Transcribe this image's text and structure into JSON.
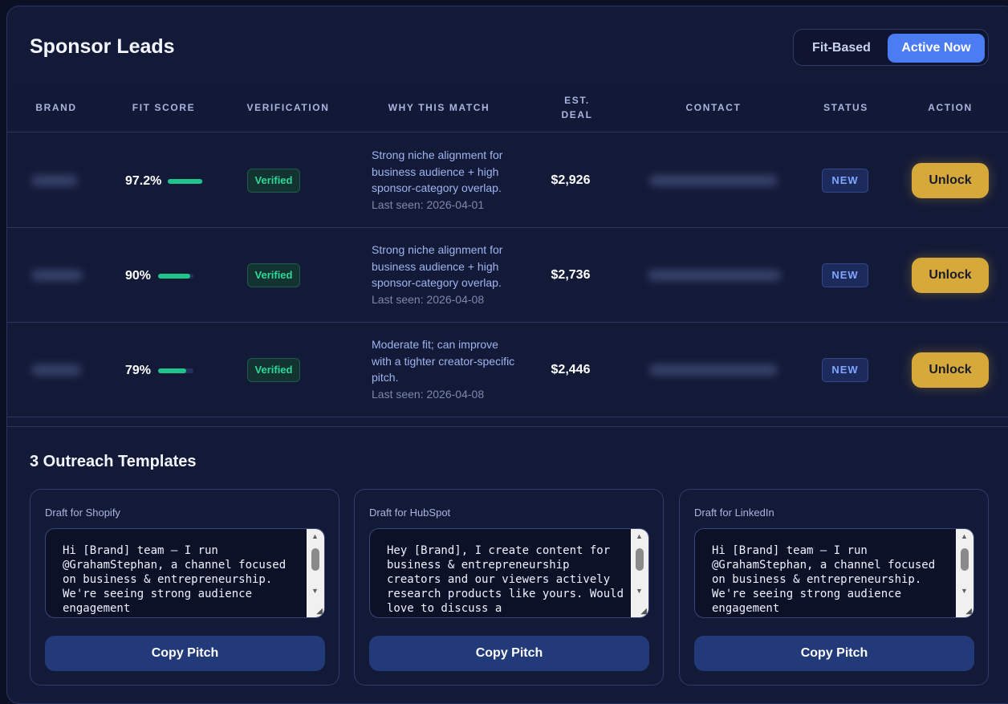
{
  "header": {
    "title": "Sponsor Leads",
    "toggle": {
      "fit": "Fit-Based",
      "active": "Active Now"
    }
  },
  "columns": {
    "brand": "BRAND",
    "fit": "FIT SCORE",
    "verification": "VERIFICATION",
    "why": "WHY THIS MATCH",
    "deal1": "EST.",
    "deal2": "DEAL",
    "contact": "CONTACT",
    "status": "STATUS",
    "action": "ACTION"
  },
  "rows": [
    {
      "score": "97.2%",
      "score_value": 97.2,
      "verification": "Verified",
      "why": "Strong niche alignment for business audience + high sponsor-category overlap.",
      "seen": "Last seen: 2026-04-01",
      "deal": "$2,926",
      "status": "NEW",
      "action": "Unlock"
    },
    {
      "score": "90%",
      "score_value": 90,
      "verification": "Verified",
      "why": "Strong niche alignment for business audience + high sponsor-category overlap.",
      "seen": "Last seen: 2026-04-08",
      "deal": "$2,736",
      "status": "NEW",
      "action": "Unlock"
    },
    {
      "score": "79%",
      "score_value": 79,
      "verification": "Verified",
      "why": "Moderate fit; can improve with a tighter creator-specific pitch.",
      "seen": "Last seen: 2026-04-08",
      "deal": "$2,446",
      "status": "NEW",
      "action": "Unlock"
    }
  ],
  "templates": {
    "title": "3 Outreach Templates",
    "cards": [
      {
        "label": "Draft for Shopify",
        "text": "Hi [Brand] team — I run @GrahamStephan, a channel focused on business & entrepreneurship. We're seeing strong audience engagement",
        "button": "Copy Pitch"
      },
      {
        "label": "Draft for HubSpot",
        "text": "Hey [Brand], I create content for business & entrepreneurship creators and our viewers actively research products like yours. Would love to discuss a",
        "button": "Copy Pitch"
      },
      {
        "label": "Draft for LinkedIn",
        "text": "Hi [Brand] team — I run @GrahamStephan, a channel focused on business & entrepreneurship. We're seeing strong audience engagement",
        "button": "Copy Pitch"
      }
    ]
  }
}
